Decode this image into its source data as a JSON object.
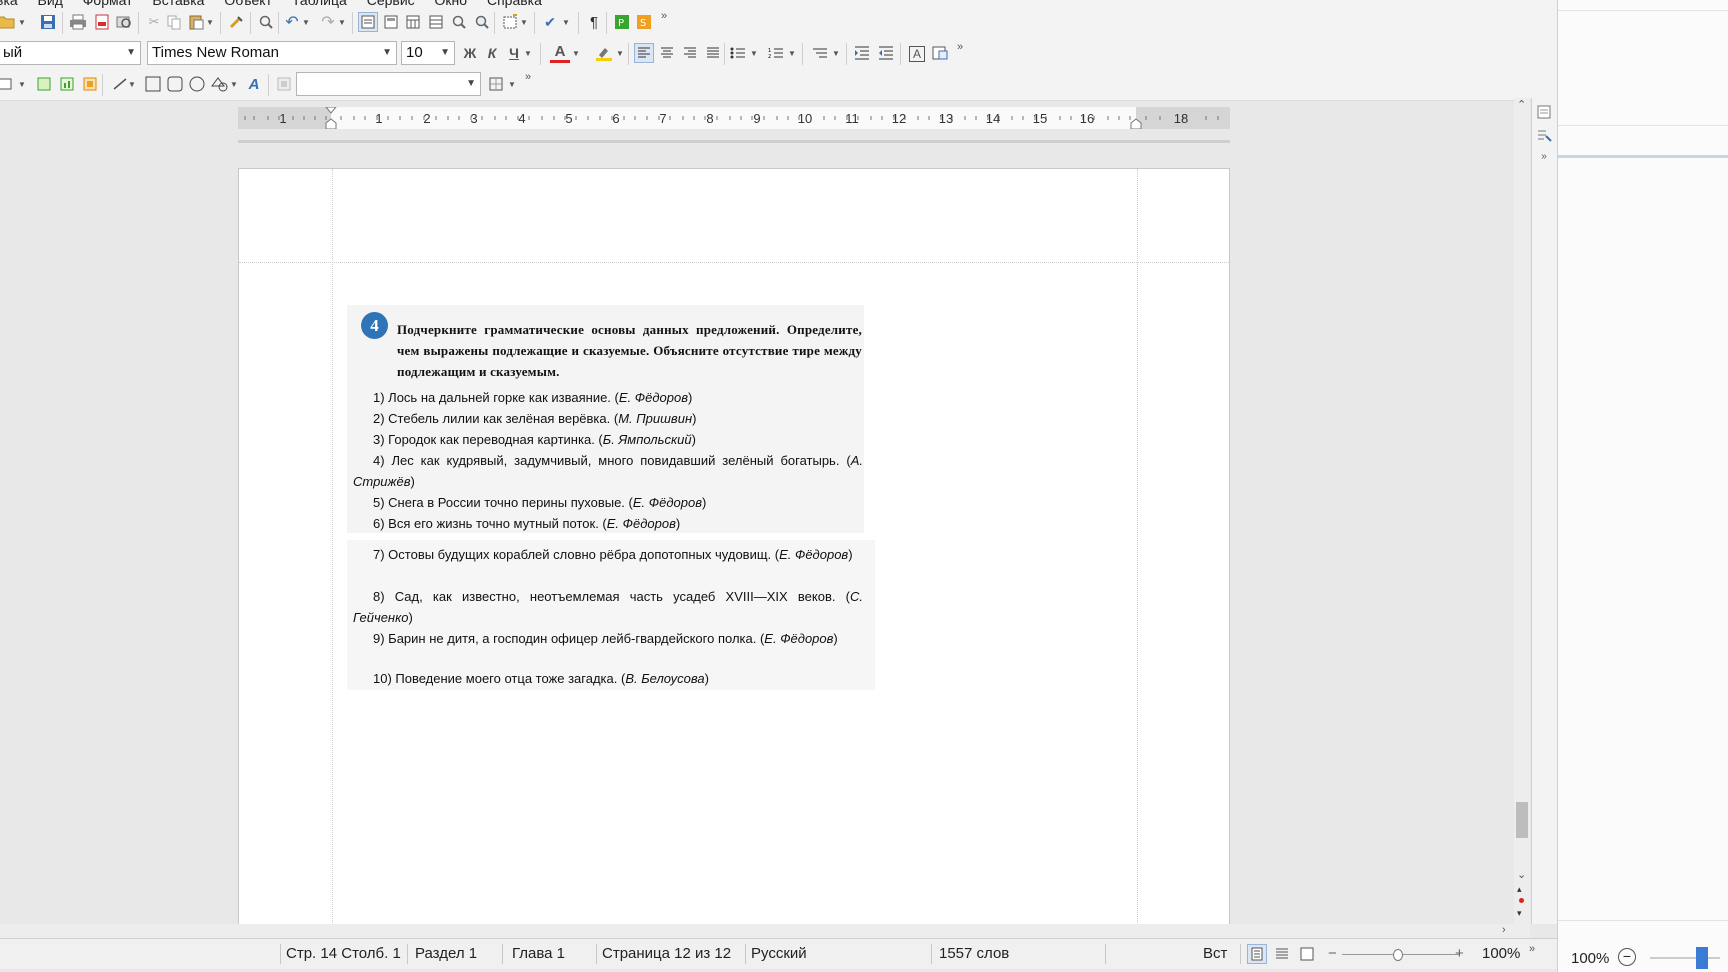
{
  "menu": [
    "вка",
    "Вид",
    "Формат",
    "Вставка",
    "Объект",
    "Таблица",
    "Сервис",
    "Окно",
    "Справка"
  ],
  "toolbar": {
    "paragraph_style": "ый",
    "font_name": "Times New Roman",
    "font_size": "10",
    "bold": "Ж",
    "italic": "К",
    "underline": "Ч",
    "font_color_glyph": "A",
    "char_frame": "A",
    "fontwork": "A",
    "overflow": "»"
  },
  "colors": {
    "font_color": "#e02020",
    "highlight": "#f5d000",
    "badge_blue": "#2f74b7",
    "green_icon": "#37a52e",
    "orange_icon": "#f0a020"
  },
  "ruler": {
    "labels": [
      "1",
      "1",
      "2",
      "3",
      "4",
      "5",
      "6",
      "7",
      "8",
      "9",
      "10",
      "11",
      "12",
      "13",
      "14",
      "15",
      "16",
      "18"
    ]
  },
  "document": {
    "task_number": "4",
    "task_text": "Подчеркните грамматические основы данных предложений. Определите, чем выражены подлежащие и сказуемые. Объясните отсутствие тире между подлежащим и сказуемым.",
    "sentences": [
      {
        "text": "1) Лось на дальней горке как изваяние. (",
        "author": "Е. Фёдоров",
        "close": ")"
      },
      {
        "text": "2) Стебель лилии как зелёная верёвка. (",
        "author": "М. Пришвин",
        "close": ")"
      },
      {
        "text": "3) Городок как переводная картинка. (",
        "author": "Б. Ямпольский",
        "close": ")"
      },
      {
        "text": "4) Лес как кудрявый, задумчивый, много повидавший зелёный богатырь. (",
        "author": "А. Стрижёв",
        "close": ")"
      },
      {
        "text": "5) Снега в России точно перины пуховые. (",
        "author": "Е. Фёдоров",
        "close": ")"
      },
      {
        "text": "6) Вся его жизнь точно мутный поток. (",
        "author": "Е. Фёдоров",
        "close": ")"
      }
    ],
    "sentences2": [
      {
        "text": "7) Остовы будущих кораблей словно рёбра допотопных чудовищ. (",
        "author": "Е. Фёдоров",
        "close": ")"
      },
      {
        "text": "8) Сад, как известно, неотъемлемая часть усадеб XVIII—XIX веков. (",
        "author": "С. Гейченко",
        "close": ")"
      },
      {
        "text": "9) Барин не дитя, а господин офицер лейб-гвардейского полка. (",
        "author": "Е. Фёдоров",
        "close": ")"
      },
      {
        "text": "10) Поведение моего отца тоже загадка. (",
        "author": "В. Белоусова",
        "close": ")"
      }
    ]
  },
  "status": {
    "position": "Стр. 14 Столб. 1",
    "section": "Раздел 1",
    "chapter": "Глава 1",
    "page": "Страница 12 из 12",
    "language": "Русский",
    "words": "1557 слов",
    "insert_mode": "Вст",
    "zoom": "100%",
    "zoom_right": "100%"
  }
}
